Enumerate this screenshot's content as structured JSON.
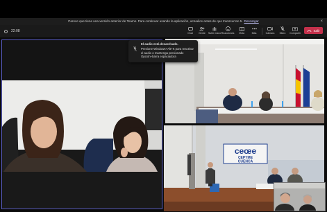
{
  "banner": {
    "text": "Parece que tiene una versión anterior de Teams. Para continuar usando la aplicación, actualice antes de que transcurran 5.",
    "link": "Descargar",
    "close": "×"
  },
  "toolbar": {
    "timer": "22:08",
    "items": [
      {
        "label": "Chat",
        "icon": "chat-icon"
      },
      {
        "label": "Gente",
        "icon": "people-icon"
      },
      {
        "label": "Subir mano",
        "icon": "raise-hand-icon"
      },
      {
        "label": "Reacciones",
        "icon": "reactions-icon"
      },
      {
        "label": "Vista",
        "icon": "view-icon"
      },
      {
        "label": "Más",
        "icon": "more-icon"
      },
      {
        "label": "Cámara",
        "icon": "camera-icon"
      },
      {
        "label": "Micro",
        "icon": "mic-icon"
      },
      {
        "label": "Compartir",
        "icon": "share-icon"
      }
    ],
    "leave_label": "Salir"
  },
  "tooltip": {
    "title": "El audio está desactivado.",
    "body": "Presione Windows+Alt+K para reactivar el audio o mantenga presionado Opción+barra espaciadora"
  },
  "stage": {
    "logo_line1": "cepyme",
    "logo_line2": "CEPYME",
    "logo_line3": "CUENCA"
  },
  "colors": {
    "accent": "#5b5fc7",
    "leave": "#c4314b",
    "toolbar_bg": "#1a1a1a",
    "banner_bg": "#1d1d1d",
    "logo_blue": "#1f3f8f"
  }
}
